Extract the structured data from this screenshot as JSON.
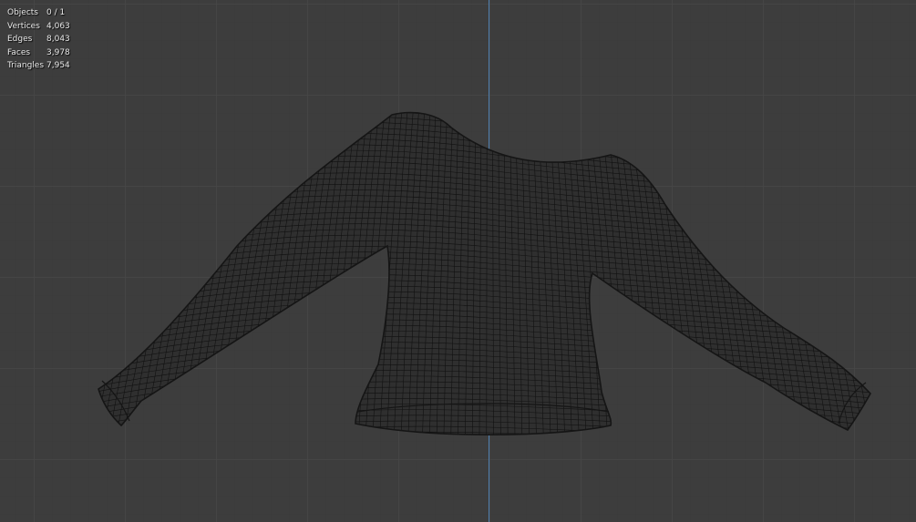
{
  "viewport": {
    "background_color": "#3d3d3d",
    "grid_color": "#464646",
    "axis_color": "#4f7faf",
    "wire_color": "#111111"
  },
  "stats": [
    {
      "label": "Objects",
      "value": "0 / 1"
    },
    {
      "label": "Vertices",
      "value": "4,063"
    },
    {
      "label": "Edges",
      "value": "8,043"
    },
    {
      "label": "Faces",
      "value": "3,978"
    },
    {
      "label": "Triangles",
      "value": "7,954"
    }
  ],
  "object": {
    "icon": "wireframe-sweater-mesh"
  }
}
